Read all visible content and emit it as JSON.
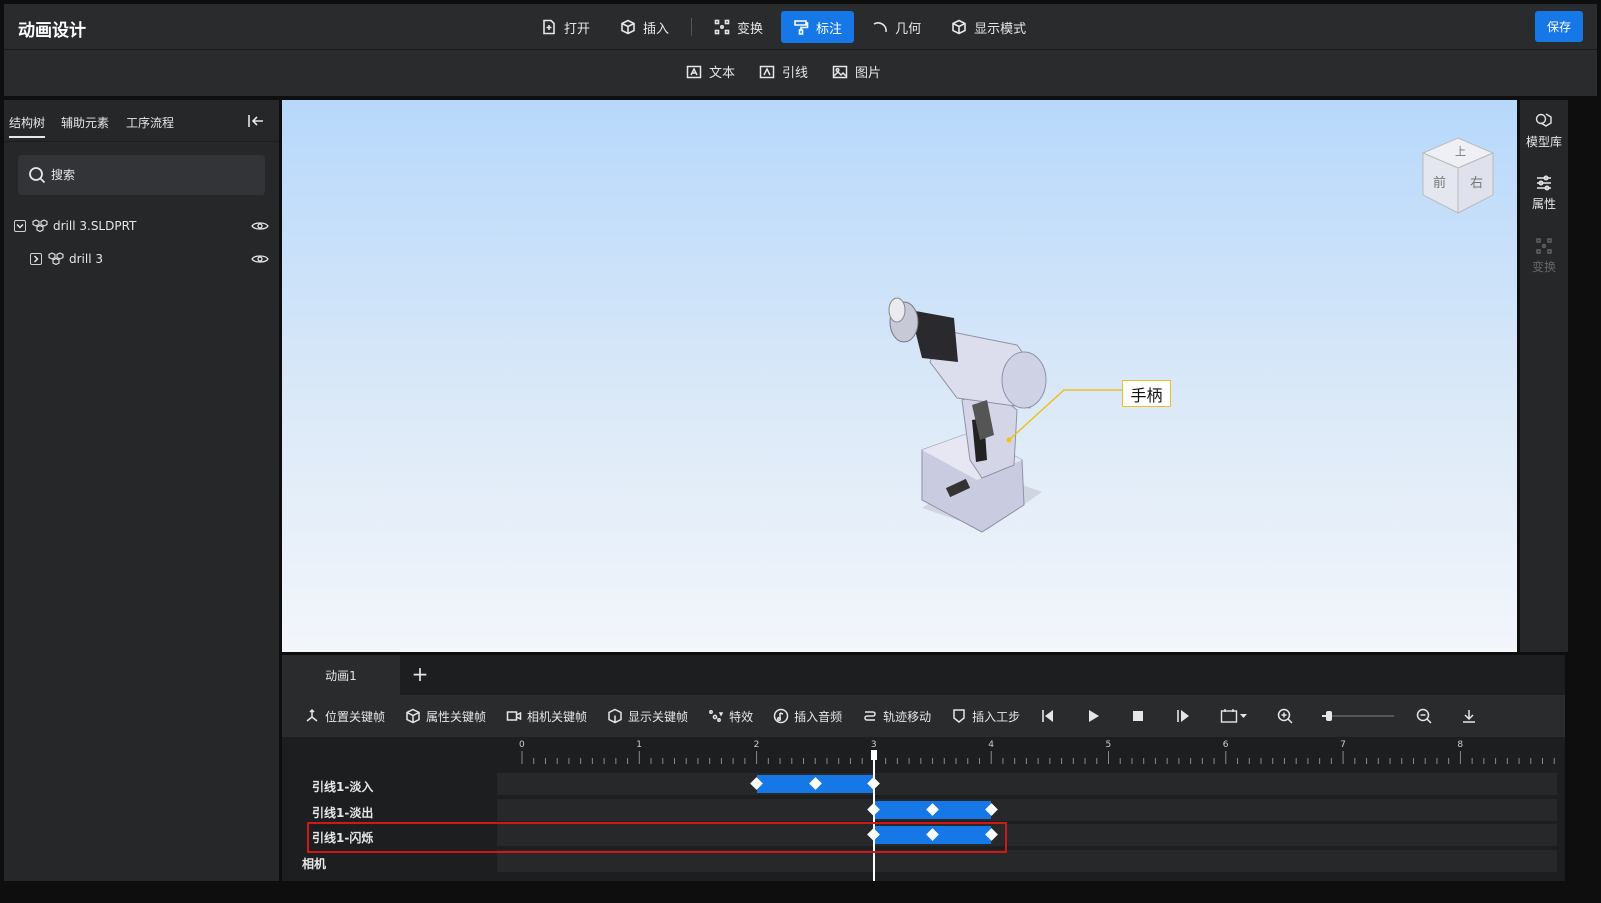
{
  "app": {
    "title": "动画设计",
    "save_label": "保存"
  },
  "toolbar": {
    "tools": [
      {
        "label": "打开",
        "icon": "open-file-icon"
      },
      {
        "label": "插入",
        "icon": "cube-insert-icon"
      },
      {
        "label": "变换",
        "icon": "transform-icon"
      },
      {
        "label": "标注",
        "icon": "annotate-brush-icon",
        "active": true
      },
      {
        "label": "几何",
        "icon": "arc-geometry-icon"
      },
      {
        "label": "显示模式",
        "icon": "cube-display-icon"
      }
    ],
    "sub_tools": [
      {
        "label": "文本",
        "icon": "text-icon"
      },
      {
        "label": "引线",
        "icon": "leader-line-icon"
      },
      {
        "label": "图片",
        "icon": "image-icon"
      }
    ]
  },
  "left_panel": {
    "tabs": [
      {
        "label": "结构树",
        "active": true
      },
      {
        "label": "辅助元素"
      },
      {
        "label": "工序流程"
      }
    ],
    "search_placeholder": "搜索",
    "tree": [
      {
        "label": "drill 3.SLDPRT",
        "expanded": true,
        "level": 0
      },
      {
        "label": "drill 3",
        "expanded": false,
        "level": 1
      }
    ]
  },
  "viewport": {
    "callout_text": "手柄",
    "viewcube_faces": {
      "top": "上",
      "front": "前",
      "right": "右"
    }
  },
  "right_panel": {
    "tools": [
      {
        "label": "模型库",
        "icon": "model-library-icon"
      },
      {
        "label": "属性",
        "icon": "properties-sliders-icon"
      },
      {
        "label": "变换",
        "icon": "transform-dots-icon",
        "disabled": true
      }
    ]
  },
  "timeline": {
    "animation_tab": "动画1",
    "keyframe_tools": [
      {
        "label": "位置关键帧",
        "icon": "position-axes-icon"
      },
      {
        "label": "属性关键帧",
        "icon": "cube-property-icon"
      },
      {
        "label": "相机关键帧",
        "icon": "camera-icon"
      },
      {
        "label": "显示关键帧",
        "icon": "display-cube-icon"
      },
      {
        "label": "特效",
        "icon": "effects-icon"
      },
      {
        "label": "插入音频",
        "icon": "audio-icon"
      },
      {
        "label": "轨迹移动",
        "icon": "path-move-icon"
      },
      {
        "label": "插入工步",
        "icon": "step-shield-icon"
      }
    ],
    "ruler_labels": [
      "0",
      "1",
      "2",
      "3",
      "4",
      "5",
      "6",
      "7",
      "8"
    ],
    "playhead_time": 3,
    "zoom_level": 0.1,
    "tracks": [
      {
        "label": "引线1-淡入",
        "start": 2,
        "end": 3,
        "keyframes": [
          2,
          2.5,
          3
        ]
      },
      {
        "label": "引线1-淡出",
        "start": 3,
        "end": 4,
        "keyframes": [
          3,
          3.5,
          4
        ]
      },
      {
        "label": "引线1-闪烁",
        "start": 3,
        "end": 4,
        "keyframes": [
          3,
          3.5,
          4
        ],
        "highlighted": true
      },
      {
        "label": "相机"
      }
    ]
  }
}
